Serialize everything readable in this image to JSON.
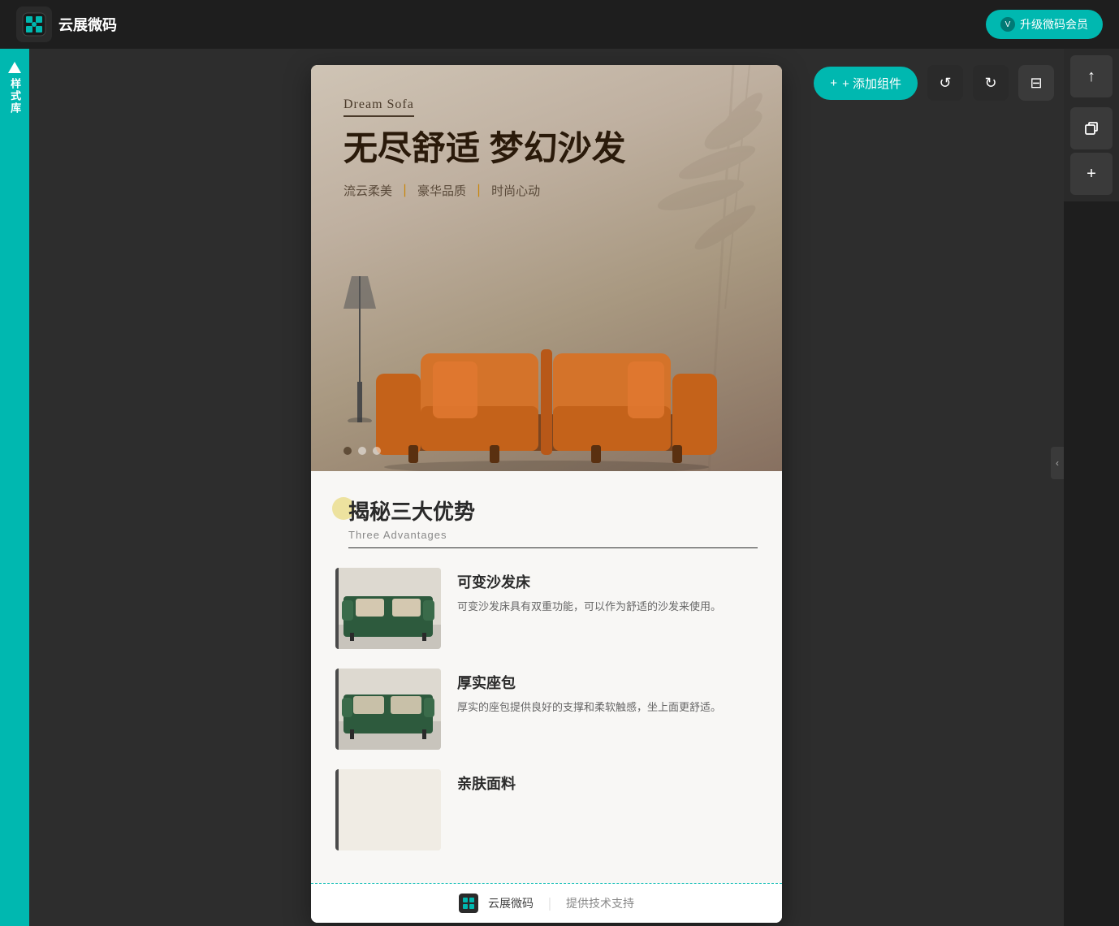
{
  "app": {
    "logo_text": "云展微码",
    "upgrade_btn": "升级微码会员",
    "upgrade_icon": "V"
  },
  "sidebar": {
    "label": "样式库"
  },
  "toolbar": {
    "add_component": "+ 添加组件",
    "upload_icon": "↑",
    "undo_icon": "↺",
    "redo_icon": "↻",
    "save_icon": "⊟",
    "copy_icon": "⧉",
    "add_icon": "+"
  },
  "hero": {
    "subtitle": "Dream Sofa",
    "title": "无尽舒适 梦幻沙发",
    "tag1": "流云柔美",
    "divider1": "｜",
    "tag2": "豪华品质",
    "divider2": "｜",
    "tag3": "时尚心动",
    "dots": [
      {
        "active": true
      },
      {
        "active": false
      },
      {
        "active": false
      }
    ]
  },
  "advantages": {
    "section_title": "揭秘三大优势",
    "section_subtitle": "Three Advantages",
    "items": [
      {
        "title": "可变沙发床",
        "desc": "可变沙发床具有双重功能，可以作为舒适的沙发来使用。"
      },
      {
        "title": "厚实座包",
        "desc": "厚实的座包提供良好的支撑和柔软触感，坐上面更舒适。"
      },
      {
        "title": "亲肤面料",
        "desc": ""
      }
    ]
  },
  "footer": {
    "brand": "云展微码",
    "divider": "｜",
    "support": "提供技术支持"
  },
  "edge_toggle": "‹"
}
